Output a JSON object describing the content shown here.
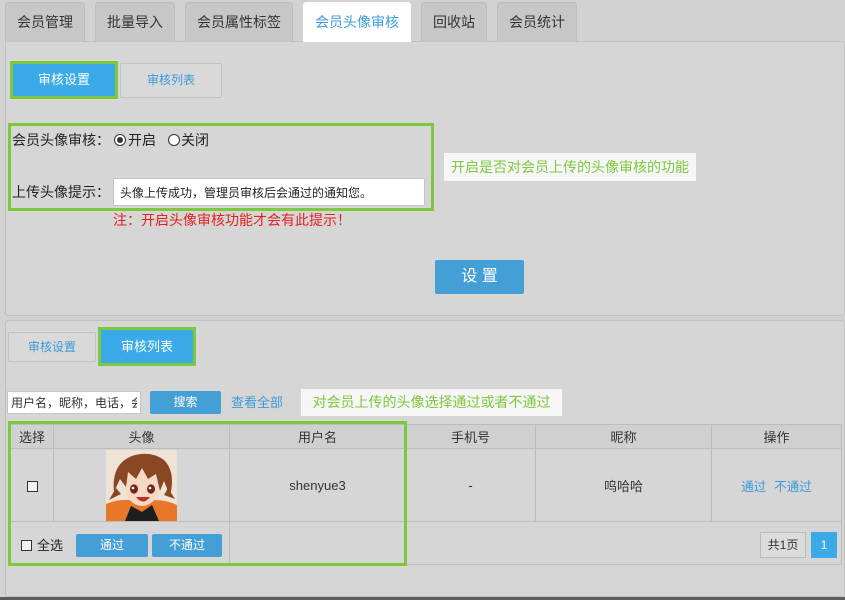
{
  "colors": {
    "accent": "#449fd6",
    "subtab_active": "#3aaae9",
    "tab_active_text": "#3b9ede",
    "highlight": "#7dc83d",
    "danger": "#e3211f",
    "link": "#3b9ad8"
  },
  "tabs": [
    {
      "label": "会员管理"
    },
    {
      "label": "批量导入"
    },
    {
      "label": "会员属性标签"
    },
    {
      "label": "会员头像审核",
      "active": true
    },
    {
      "label": "回收站"
    },
    {
      "label": "会员统计"
    }
  ],
  "settings_panel": {
    "subtabs": [
      {
        "label": "审核设置",
        "active": true
      },
      {
        "label": "审核列表"
      }
    ],
    "review_label": "会员头像审核：",
    "review_options": [
      {
        "label": "开启",
        "checked": true
      },
      {
        "label": "关闭",
        "checked": false
      }
    ],
    "hint_label": "上传头像提示：",
    "hint_value": "头像上传成功，管理员审核后会通过的通知您。",
    "note": "注：开启头像审核功能才会有此提示！",
    "submit_label": "设 置",
    "callout": "开启是否对会员上传的头像审核的功能"
  },
  "list_panel": {
    "subtabs": [
      {
        "label": "审核设置"
      },
      {
        "label": "审核列表",
        "active": true
      }
    ],
    "search": {
      "placeholder": "用户名，昵称，电话，会员",
      "button_label": "搜索",
      "view_all_label": "查看全部"
    },
    "callout": "对会员上传的头像选择通过或者不通过",
    "table": {
      "columns": [
        "选择",
        "头像",
        "用户名",
        "手机号",
        "昵称",
        "操作"
      ],
      "rows": [
        {
          "selected": false,
          "username": "shenyue3",
          "phone": "-",
          "nickname": "呜哈哈",
          "actions": [
            "通过",
            "不通过"
          ]
        }
      ]
    },
    "footer": {
      "select_all_label": "全选",
      "approve_label": "通过",
      "reject_label": "不通过"
    },
    "pagination": {
      "total_label": "共1页",
      "pages": [
        {
          "label": "1",
          "current": true
        }
      ]
    }
  }
}
